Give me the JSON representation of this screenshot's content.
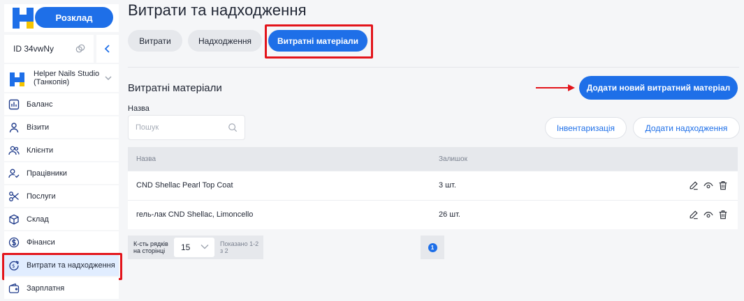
{
  "sidebar": {
    "schedule_label": "Розклад",
    "id_label": "ID 34vwNy",
    "studio_name": "Helper Nails Studio (Танкопія)",
    "items": [
      {
        "label": "Баланс",
        "icon": "chart-bar-icon"
      },
      {
        "label": "Візити",
        "icon": "person-icon"
      },
      {
        "label": "Клієнти",
        "icon": "people-icon"
      },
      {
        "label": "Працівники",
        "icon": "user-check-icon"
      },
      {
        "label": "Послуги",
        "icon": "scissors-icon"
      },
      {
        "label": "Склад",
        "icon": "box-icon"
      },
      {
        "label": "Фінанси",
        "icon": "dollar-circle-icon"
      },
      {
        "label": "Витрати та надходження",
        "icon": "expenses-icon",
        "active": true
      },
      {
        "label": "Зарплатня",
        "icon": "wallet-icon"
      }
    ]
  },
  "main": {
    "title": "Витрати та надходження",
    "tabs": [
      {
        "label": "Витрати"
      },
      {
        "label": "Надходження"
      },
      {
        "label": "Витратні матеріали",
        "active": true
      }
    ],
    "section_title": "Витратні матеріали",
    "add_consumable_label": "Додати новий витратний матеріал",
    "search": {
      "label": "Назва",
      "placeholder": "Пошук"
    },
    "inventory_label": "Інвентаризація",
    "add_income_label": "Додати надходження",
    "table": {
      "headers": [
        "Назва",
        "Залишок"
      ],
      "rows": [
        {
          "name": "CND Shellac Pearl Top Coat",
          "stock": "3 шт."
        },
        {
          "name": "гель-лак CND Shellac, Limoncello",
          "stock": "26 шт."
        }
      ]
    },
    "pagination": {
      "rows_per_page_label": "К-сть рядків на сторінці",
      "rows_per_page_value": "15",
      "shown_label": "Показано 1-2 з 2",
      "current_page": "1"
    }
  },
  "colors": {
    "accent": "#1e6fe8",
    "highlight": "#e3141b",
    "logo_yellow": "#f5c400"
  }
}
